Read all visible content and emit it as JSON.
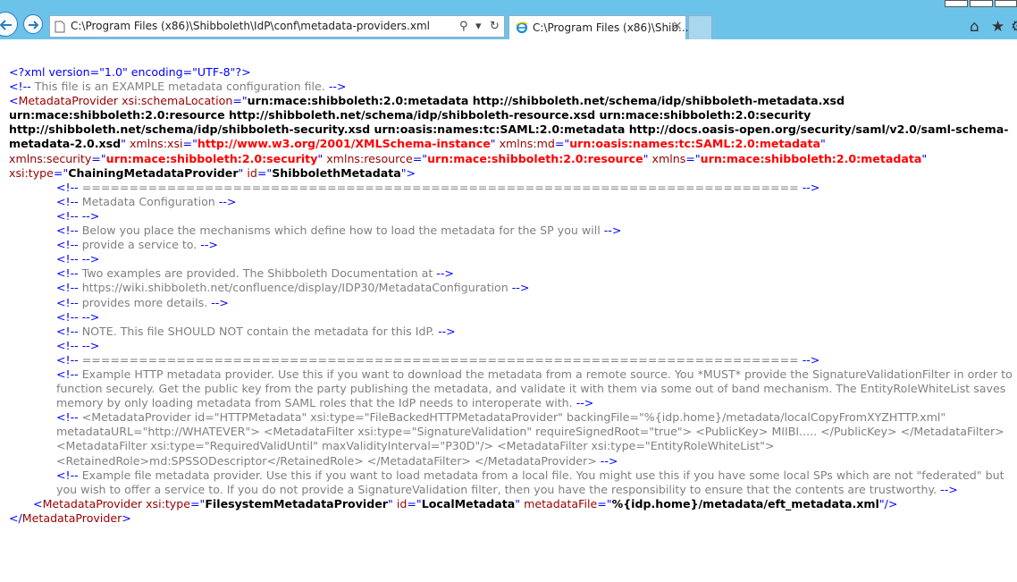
{
  "browser": {
    "address_url": "C:\\Program Files (x86)\\Shibboleth\\IdP\\conf\\metadata-providers.xml",
    "search_glyph": "⚲",
    "dropdown_glyph": "▾",
    "refresh_glyph": "↻",
    "tab_title": "C:\\Program Files (x86)\\Shib...",
    "tab_close": "×",
    "home_glyph": "⌂",
    "star_glyph": "★",
    "gear_glyph": "⚙"
  },
  "xml": {
    "pi": "<?xml version=\"1.0\" encoding=\"UTF-8\"?>",
    "comment_example": "This file is an EXAMPLE metadata configuration file.",
    "root_tag": "MetadataProvider",
    "root_attrs": [
      {
        "name": "xsi:schemaLocation",
        "value": "urn:mace:shibboleth:2.0:metadata http://shibboleth.net/schema/idp/shibboleth-metadata.xsd urn:mace:shibboleth:2.0:resource http://shibboleth.net/schema/idp/shibboleth-resource.xsd urn:mace:shibboleth:2.0:security http://shibboleth.net/schema/idp/shibboleth-security.xsd urn:oasis:names:tc:SAML:2.0:metadata http://docs.oasis-open.org/security/saml/v2.0/saml-schema-metadata-2.0.xsd",
        "ns": false
      },
      {
        "name": "xmlns:xsi",
        "value": "http://www.w3.org/2001/XMLSchema-instance",
        "ns": true
      },
      {
        "name": "xmlns:md",
        "value": "urn:oasis:names:tc:SAML:2.0:metadata",
        "ns": true
      },
      {
        "name": "xmlns:security",
        "value": "urn:mace:shibboleth:2.0:security",
        "ns": true
      },
      {
        "name": "xmlns:resource",
        "value": "urn:mace:shibboleth:2.0:resource",
        "ns": true
      },
      {
        "name": "xmlns",
        "value": "urn:mace:shibboleth:2.0:metadata",
        "ns": true
      },
      {
        "name": "xsi:type",
        "value": "ChainingMetadataProvider",
        "ns": false
      },
      {
        "name": "id",
        "value": "ShibbolethMetadata",
        "ns": false
      }
    ],
    "comments": [
      "============================================================================",
      "Metadata Configuration",
      "",
      "Below you place the mechanisms which define how to load the metadata for the SP you will",
      "provide a service to.",
      "",
      "Two examples are provided. The Shibboleth Documentation at",
      "https://wiki.shibboleth.net/confluence/display/IDP30/MetadataConfiguration",
      "provides more details.",
      "",
      "NOTE. This file SHOULD NOT contain the metadata for this IdP.",
      "",
      "============================================================================"
    ],
    "comment_http": "Example HTTP metadata provider. Use this if you want to download the metadata from a remote source. You *MUST* provide the SignatureValidationFilter in order to function securely. Get the public key from the party publishing the metadata, and validate it with them via some out of band mechanism. The EntityRoleWhiteList saves memory by only loading metadata from SAML roles that the IdP needs to interoperate with.",
    "comment_http_xml": "<MetadataProvider id=\"HTTPMetadata\" xsi:type=\"FileBackedHTTPMetadataProvider\" backingFile=\"%{idp.home}/metadata/localCopyFromXYZHTTP.xml\" metadataURL=\"http://WHATEVER\"> <MetadataFilter xsi:type=\"SignatureValidation\" requireSignedRoot=\"true\"> <PublicKey> MIIBI..... </PublicKey> </MetadataFilter> <MetadataFilter xsi:type=\"RequiredValidUntil\" maxValidityInterval=\"P30D\"/> <MetadataFilter xsi:type=\"EntityRoleWhiteList\"> <RetainedRole>md:SPSSODescriptor</RetainedRole> </MetadataFilter> </MetadataProvider>",
    "comment_file": "Example file metadata provider. Use this if you want to load metadata from a local file. You might use this if you have some local SPs which are not \"federated\" but you wish to offer a service to. If you do not provide a SignatureValidation filter, then you have the responsibility to ensure that the contents are trustworthy.",
    "child_tag": "MetadataProvider",
    "child_attrs": [
      {
        "name": "xsi:type",
        "value": "FilesystemMetadataProvider"
      },
      {
        "name": "id",
        "value": "LocalMetadata"
      },
      {
        "name": "metadataFile",
        "value": "%{idp.home}/metadata/eft_metadata.xml"
      }
    ],
    "close_tag": "MetadataProvider"
  }
}
